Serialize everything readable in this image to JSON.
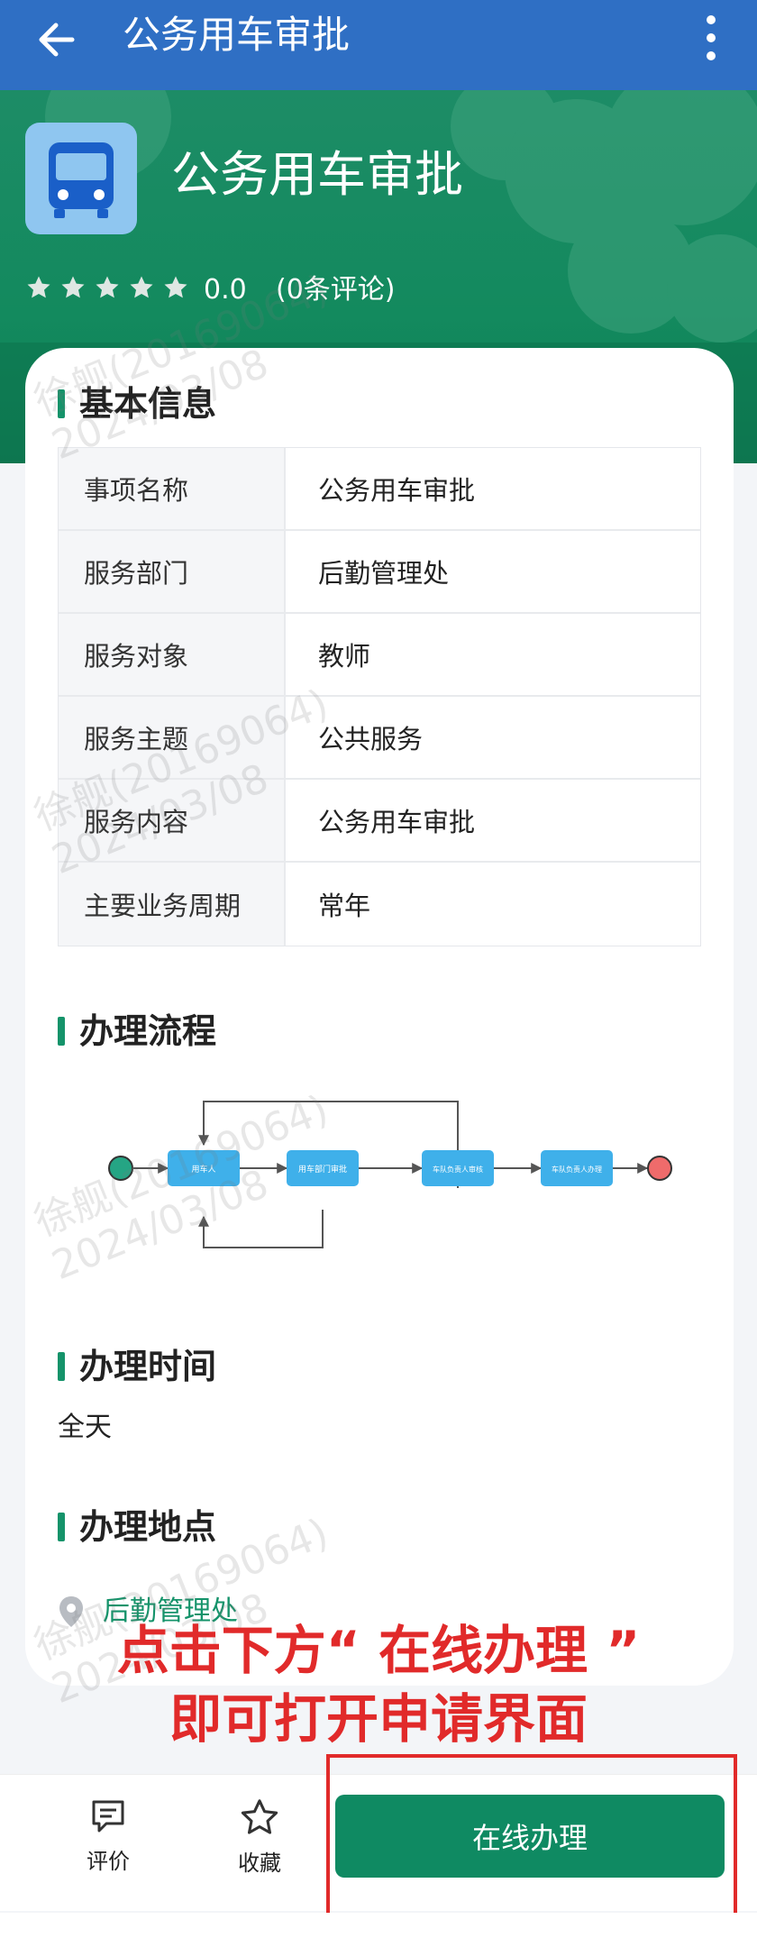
{
  "topbar": {
    "title": "公务用车审批"
  },
  "hero": {
    "app_title": "公务用车审批",
    "rating": {
      "stars_filled": 0,
      "stars_total": 5,
      "score": "0.0",
      "review_count_text": "(0条评论)"
    }
  },
  "sections": {
    "basic_info": {
      "title": "基本信息",
      "rows": [
        {
          "label": "事项名称",
          "value": "公务用车审批"
        },
        {
          "label": "服务部门",
          "value": "后勤管理处"
        },
        {
          "label": "服务对象",
          "value": "教师"
        },
        {
          "label": "服务主题",
          "value": "公共服务"
        },
        {
          "label": "服务内容",
          "value": "公务用车审批"
        },
        {
          "label": "主要业务周期",
          "value": "常年"
        }
      ]
    },
    "process": {
      "title": "办理流程",
      "nodes": [
        "用车人",
        "用车部门审批",
        "车队负责人审核",
        "车队负责人办理"
      ]
    },
    "time": {
      "title": "办理时间",
      "value": "全天"
    },
    "location": {
      "title": "办理地点",
      "value": "后勤管理处"
    }
  },
  "watermark": {
    "name": "徐舰(20169064)",
    "date": "2024/03/08"
  },
  "annotation": {
    "line1": "点击下方“ 在线办理 ”",
    "line2": "即可打开申请界面"
  },
  "bottom_bar": {
    "review_label": "评价",
    "favorite_label": "收藏",
    "primary_label": "在线办理"
  },
  "colors": {
    "topbar": "#2f6fc4",
    "hero": "#138a5e",
    "primary": "#0f8a62",
    "accent": "#15936a",
    "annotation": "#e12a2a"
  }
}
